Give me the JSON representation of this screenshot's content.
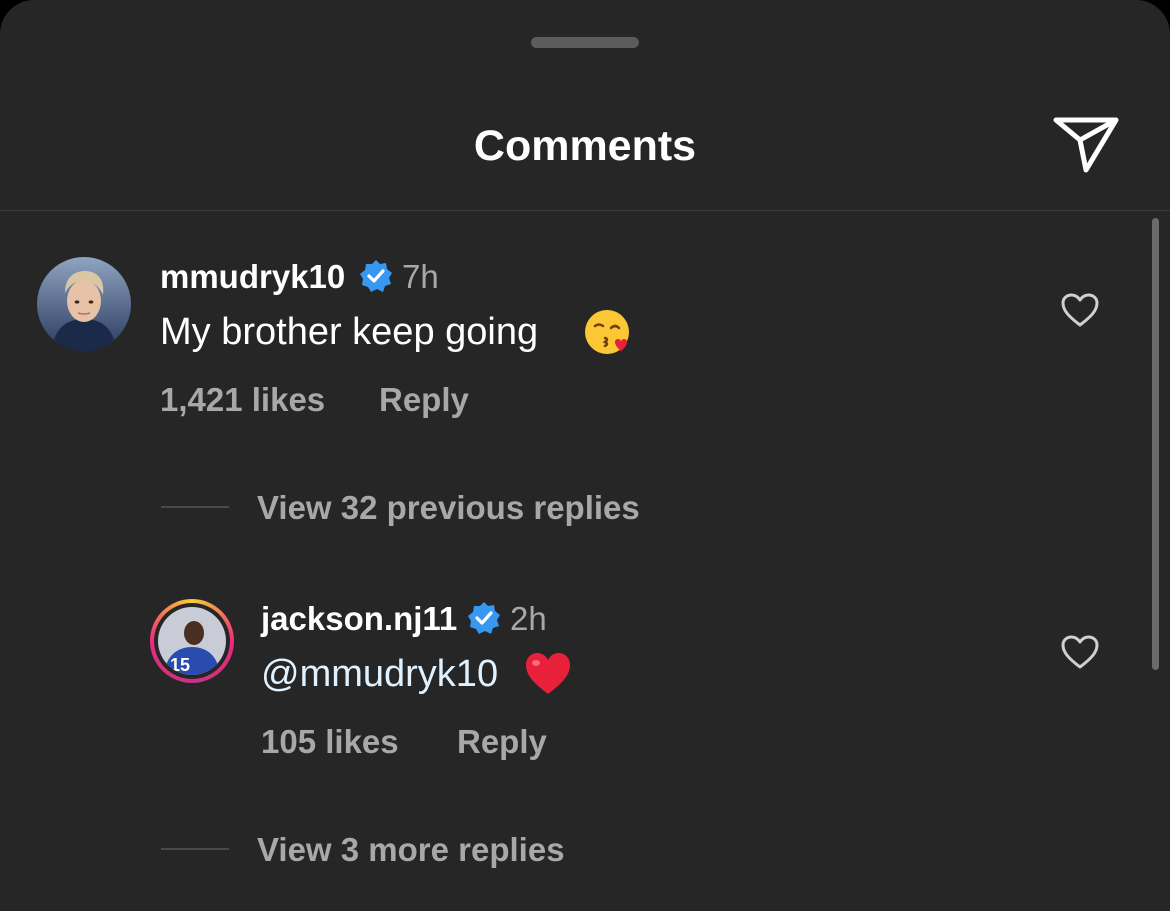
{
  "header": {
    "title": "Comments",
    "share_icon": "paper-plane-icon"
  },
  "comments": [
    {
      "username": "mmudryk10",
      "verified": true,
      "time": "7h",
      "text": "My brother keep going",
      "emoji": "kissing-heart-emoji",
      "likes": "1,421 likes",
      "reply_label": "Reply",
      "view_replies": "View 32 previous replies"
    },
    {
      "username": "jackson.nj11",
      "verified": true,
      "time": "2h",
      "mention": "@mmudryk10",
      "emoji": "red-heart-emoji",
      "likes": "105 likes",
      "reply_label": "Reply",
      "view_replies": "View 3 more replies"
    }
  ],
  "colors": {
    "background": "#262626",
    "text_primary": "#ffffff",
    "text_secondary": "#a8a8a8",
    "verified_blue": "#3897f0",
    "heart_red": "#e8203a"
  }
}
